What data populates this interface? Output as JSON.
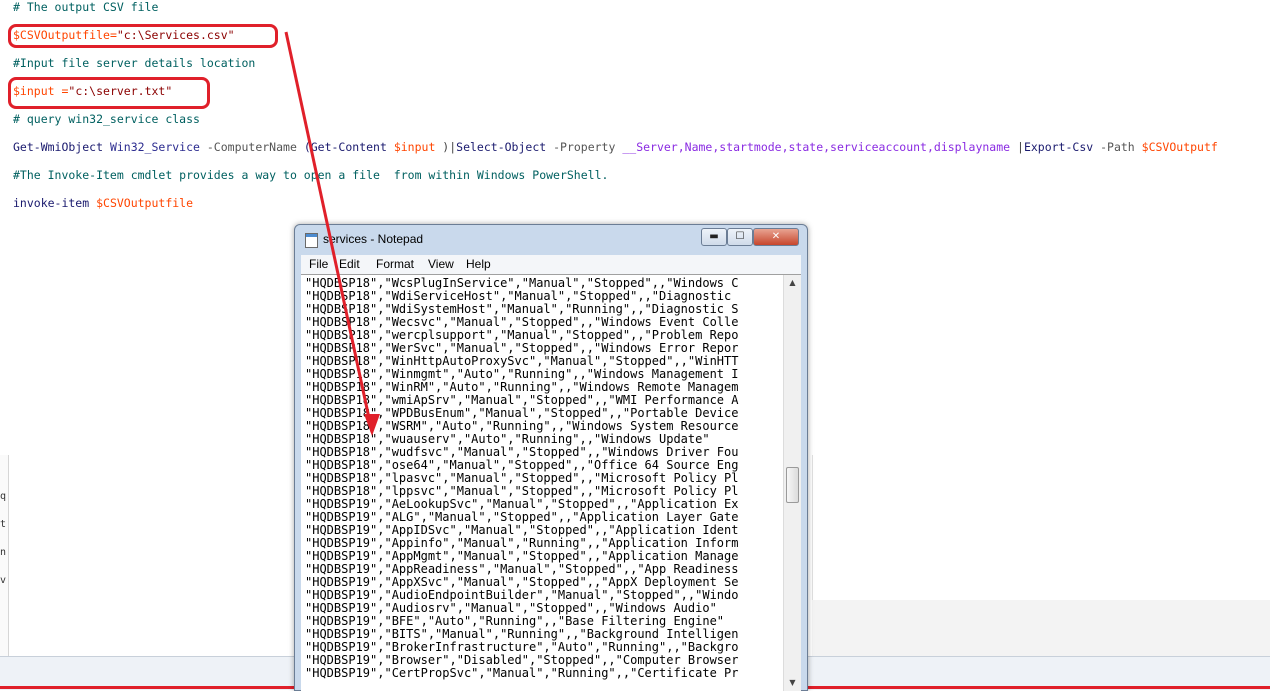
{
  "editor": {
    "comment_output": "# The output CSV file",
    "var_csv": "$CSVOutputfile",
    "eq1": "=",
    "str_csv": "\"c:\\Services.csv\"",
    "comment_input": "#Input file server details location",
    "var_input": "$input",
    "eq2": " =",
    "str_input": "\"c:\\server.txt\"",
    "comment_query": "# query win32_service class",
    "cmd_get": "Get-WmiObject ",
    "cmd_class": "Win32_Service ",
    "cmd_param": "-ComputerName ",
    "cmd_paren_open": "(Get-Content ",
    "cmd_var_input": "$input",
    "cmd_paren_close": " )|",
    "cmd_select": "Select-Object ",
    "cmd_prop_param": "-Property ",
    "cmd_props": "__Server,Name,startmode,state,serviceaccount,displayname ",
    "cmd_pipe2": "|",
    "cmd_export": "Export-Csv ",
    "cmd_path": "-Path ",
    "cmd_var_out": "$CSVOutputf",
    "comment_invoke": "#The Invoke-Item cmdlet provides a way to open a file  from within Windows PowerShell.",
    "invoke_cmd": "invoke-item ",
    "invoke_var": "$CSVOutputfile"
  },
  "left_strip": [
    "q",
    "t",
    "n",
    "v"
  ],
  "notepad": {
    "title": "services - Notepad",
    "menu": [
      "File",
      "Edit",
      "Format",
      "View",
      "Help"
    ],
    "min_glyph": "▬",
    "max_glyph": "☐",
    "close_glyph": "✕",
    "scroll_up": "▲",
    "scroll_down": "▼",
    "lines": [
      "\"HQDBSP18\",\"WcsPlugInService\",\"Manual\",\"Stopped\",,\"Windows C",
      "\"HQDBSP18\",\"WdiServiceHost\",\"Manual\",\"Stopped\",,\"Diagnostic",
      "\"HQDBSP18\",\"WdiSystemHost\",\"Manual\",\"Running\",,\"Diagnostic S",
      "\"HQDBSP18\",\"Wecsvc\",\"Manual\",\"Stopped\",,\"Windows Event Colle",
      "\"HQDBSP18\",\"wercplsupport\",\"Manual\",\"Stopped\",,\"Problem Repo",
      "\"HQDBSP18\",\"WerSvc\",\"Manual\",\"Stopped\",,\"Windows Error Repor",
      "\"HQDBSP18\",\"WinHttpAutoProxySvc\",\"Manual\",\"Stopped\",,\"WinHTT",
      "\"HQDBSP18\",\"Winmgmt\",\"Auto\",\"Running\",,\"Windows Management I",
      "\"HQDBSP18\",\"WinRM\",\"Auto\",\"Running\",,\"Windows Remote Managem",
      "\"HQDBSP18\",\"wmiApSrv\",\"Manual\",\"Stopped\",,\"WMI Performance A",
      "\"HQDBSP18\",\"WPDBusEnum\",\"Manual\",\"Stopped\",,\"Portable Device",
      "\"HQDBSP18\",\"WSRM\",\"Auto\",\"Running\",,\"Windows System Resource",
      "\"HQDBSP18\",\"wuauserv\",\"Auto\",\"Running\",,\"Windows Update\"",
      "\"HQDBSP18\",\"wudfsvc\",\"Manual\",\"Stopped\",,\"Windows Driver Fou",
      "\"HQDBSP18\",\"ose64\",\"Manual\",\"Stopped\",,\"Office 64 Source Eng",
      "\"HQDBSP18\",\"lpasvc\",\"Manual\",\"Stopped\",,\"Microsoft Policy Pl",
      "\"HQDBSP18\",\"lppsvc\",\"Manual\",\"Stopped\",,\"Microsoft Policy Pl",
      "\"HQDBSP19\",\"AeLookupSvc\",\"Manual\",\"Stopped\",,\"Application Ex",
      "\"HQDBSP19\",\"ALG\",\"Manual\",\"Stopped\",,\"Application Layer Gate",
      "\"HQDBSP19\",\"AppIDSvc\",\"Manual\",\"Stopped\",,\"Application Ident",
      "\"HQDBSP19\",\"Appinfo\",\"Manual\",\"Running\",,\"Application Inform",
      "\"HQDBSP19\",\"AppMgmt\",\"Manual\",\"Stopped\",,\"Application Manage",
      "\"HQDBSP19\",\"AppReadiness\",\"Manual\",\"Stopped\",,\"App Readiness",
      "\"HQDBSP19\",\"AppXSvc\",\"Manual\",\"Stopped\",,\"AppX Deployment Se",
      "\"HQDBSP19\",\"AudioEndpointBuilder\",\"Manual\",\"Stopped\",,\"Windo",
      "\"HQDBSP19\",\"Audiosrv\",\"Manual\",\"Stopped\",,\"Windows Audio\"",
      "\"HQDBSP19\",\"BFE\",\"Auto\",\"Running\",,\"Base Filtering Engine\"",
      "\"HQDBSP19\",\"BITS\",\"Manual\",\"Running\",,\"Background Intelligen",
      "\"HQDBSP19\",\"BrokerInfrastructure\",\"Auto\",\"Running\",,\"Backgro",
      "\"HQDBSP19\",\"Browser\",\"Disabled\",\"Stopped\",,\"Computer Browser",
      "\"HQDBSP19\",\"CertPropSvc\",\"Manual\",\"Running\",,\"Certificate Pr"
    ]
  },
  "colors": {
    "highlight": "#e0202a",
    "notepad_frame": "#c9d9ec"
  }
}
